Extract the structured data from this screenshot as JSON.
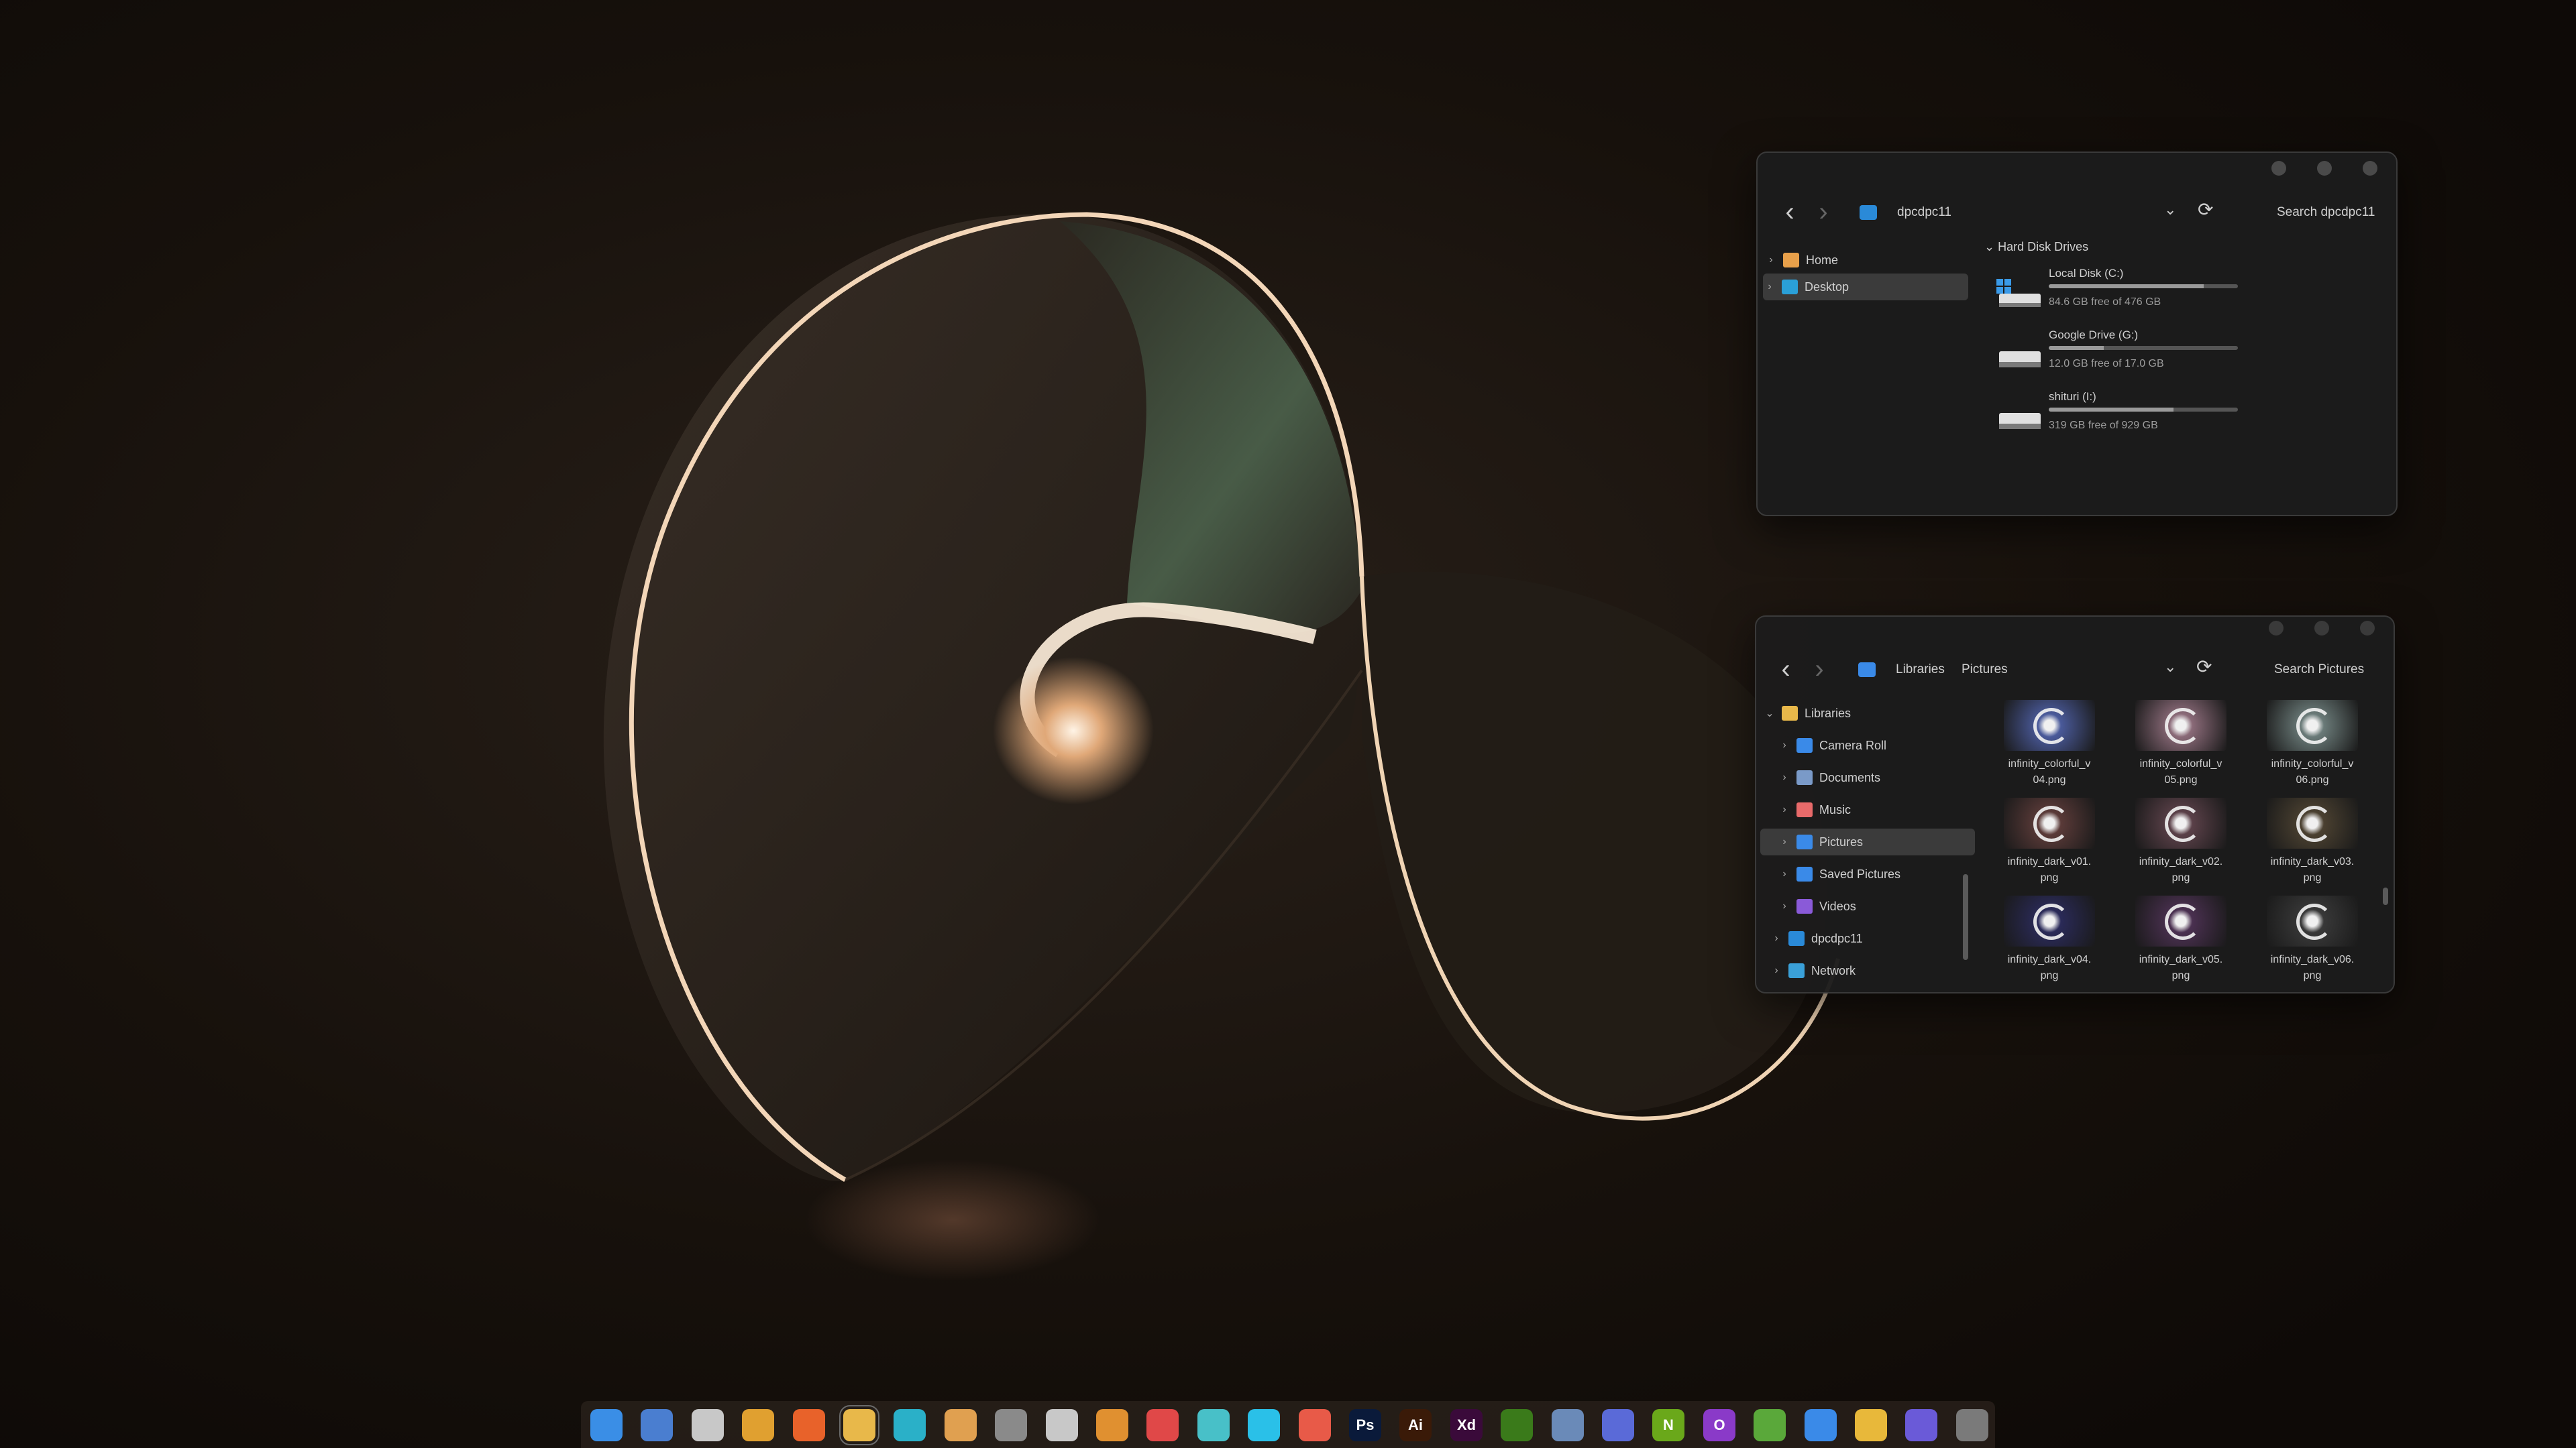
{
  "window_pc": {
    "address": "dpcdpc11",
    "search_placeholder": "Search dpcdpc11",
    "nav": [
      {
        "label": "Home",
        "icon": "home-icon"
      },
      {
        "label": "Desktop",
        "icon": "desktop-icon",
        "selected": true
      }
    ],
    "section_title": "Hard Disk Drives",
    "drives": [
      {
        "name": "Local Disk (C:)",
        "free_text": "84.6 GB free of 476 GB",
        "used_fraction": 0.82,
        "icon": "windows-drive-icon"
      },
      {
        "name": "Google Drive (G:)",
        "free_text": "12.0 GB free of 17.0 GB",
        "used_fraction": 0.29,
        "icon": "drive-icon"
      },
      {
        "name": "shituri (I:)",
        "free_text": "319 GB free of 929 GB",
        "used_fraction": 0.66,
        "icon": "drive-icon"
      }
    ]
  },
  "window_pics": {
    "breadcrumb": [
      "Libraries",
      "Pictures"
    ],
    "search_placeholder": "Search Pictures",
    "nav": [
      {
        "label": "Libraries",
        "expanded": true
      },
      {
        "label": "Camera Roll"
      },
      {
        "label": "Documents"
      },
      {
        "label": "Music"
      },
      {
        "label": "Pictures",
        "selected": true
      },
      {
        "label": "Saved Pictures"
      },
      {
        "label": "Videos"
      },
      {
        "label": "dpcdpc11"
      },
      {
        "label": "Network"
      }
    ],
    "files": [
      {
        "name": "infinity_colorful_v\n04.png",
        "color": "#4a5a9a"
      },
      {
        "name": "infinity_colorful_v\n05.png",
        "color": "#8a6a78"
      },
      {
        "name": "infinity_colorful_v\n06.png",
        "color": "#6a7a78"
      },
      {
        "name": "infinity_dark_v01.\npng",
        "color": "#5a3a38"
      },
      {
        "name": "infinity_dark_v02.\npng",
        "color": "#5a4048"
      },
      {
        "name": "infinity_dark_v03.\npng",
        "color": "#4a4030"
      },
      {
        "name": "infinity_dark_v04.\npng",
        "color": "#2a2a58"
      },
      {
        "name": "infinity_dark_v05.\npng",
        "color": "#4a3050"
      },
      {
        "name": "infinity_dark_v06.\npng",
        "color": "#383838"
      }
    ]
  },
  "taskbar": {
    "apps": [
      {
        "name": "start-button",
        "label": "",
        "color": "#3a8ee6"
      },
      {
        "name": "app-activity-monitor",
        "label": "",
        "color": "#4a7ed0"
      },
      {
        "name": "app-notes",
        "label": "",
        "color": "#c8c8c8"
      },
      {
        "name": "app-chrome",
        "label": "",
        "color": "#e0a030"
      },
      {
        "name": "app-firefox",
        "label": "",
        "color": "#e8622a"
      },
      {
        "name": "app-file-explorer",
        "label": "",
        "color": "#e8b84a",
        "active": true
      },
      {
        "name": "app-window-manager",
        "label": "",
        "color": "#2ab0c8"
      },
      {
        "name": "app-save",
        "label": "",
        "color": "#e0a050"
      },
      {
        "name": "app-speaker",
        "label": "",
        "color": "#8a8a8a"
      },
      {
        "name": "app-media-player",
        "label": "",
        "color": "#c8c8c8"
      },
      {
        "name": "app-video-player",
        "label": "",
        "color": "#e09030"
      },
      {
        "name": "app-youtube",
        "label": "",
        "color": "#e04848"
      },
      {
        "name": "app-image-viewer",
        "label": "",
        "color": "#48c0c8"
      },
      {
        "name": "app-affinity-designer",
        "label": "",
        "color": "#2ac0e8"
      },
      {
        "name": "app-affinity-publisher",
        "label": "",
        "color": "#e85a48"
      },
      {
        "name": "app-photoshop",
        "label": "Ps",
        "color": "#0a1a3a"
      },
      {
        "name": "app-illustrator",
        "label": "Ai",
        "color": "#3a1a08"
      },
      {
        "name": "app-xd",
        "label": "Xd",
        "color": "#3a0a3a"
      },
      {
        "name": "app-green-logo",
        "label": "",
        "color": "#3a7a1a"
      },
      {
        "name": "app-control-panel",
        "label": "",
        "color": "#6a8ab8"
      },
      {
        "name": "app-code-editor",
        "label": "",
        "color": "#5a6ad8"
      },
      {
        "name": "app-nvidia",
        "label": "N",
        "color": "#6aa81a"
      },
      {
        "name": "app-onenote",
        "label": "O",
        "color": "#8a3ac8"
      },
      {
        "name": "app-chat-green",
        "label": "",
        "color": "#5aa83a"
      },
      {
        "name": "app-chat-blue",
        "label": "",
        "color": "#3a8ae8"
      },
      {
        "name": "app-chat-yellow",
        "label": "",
        "color": "#e8b83a"
      },
      {
        "name": "app-chat-purple",
        "label": "",
        "color": "#6a5ad8"
      },
      {
        "name": "app-camera",
        "label": "",
        "color": "#7a7a7a"
      }
    ]
  }
}
